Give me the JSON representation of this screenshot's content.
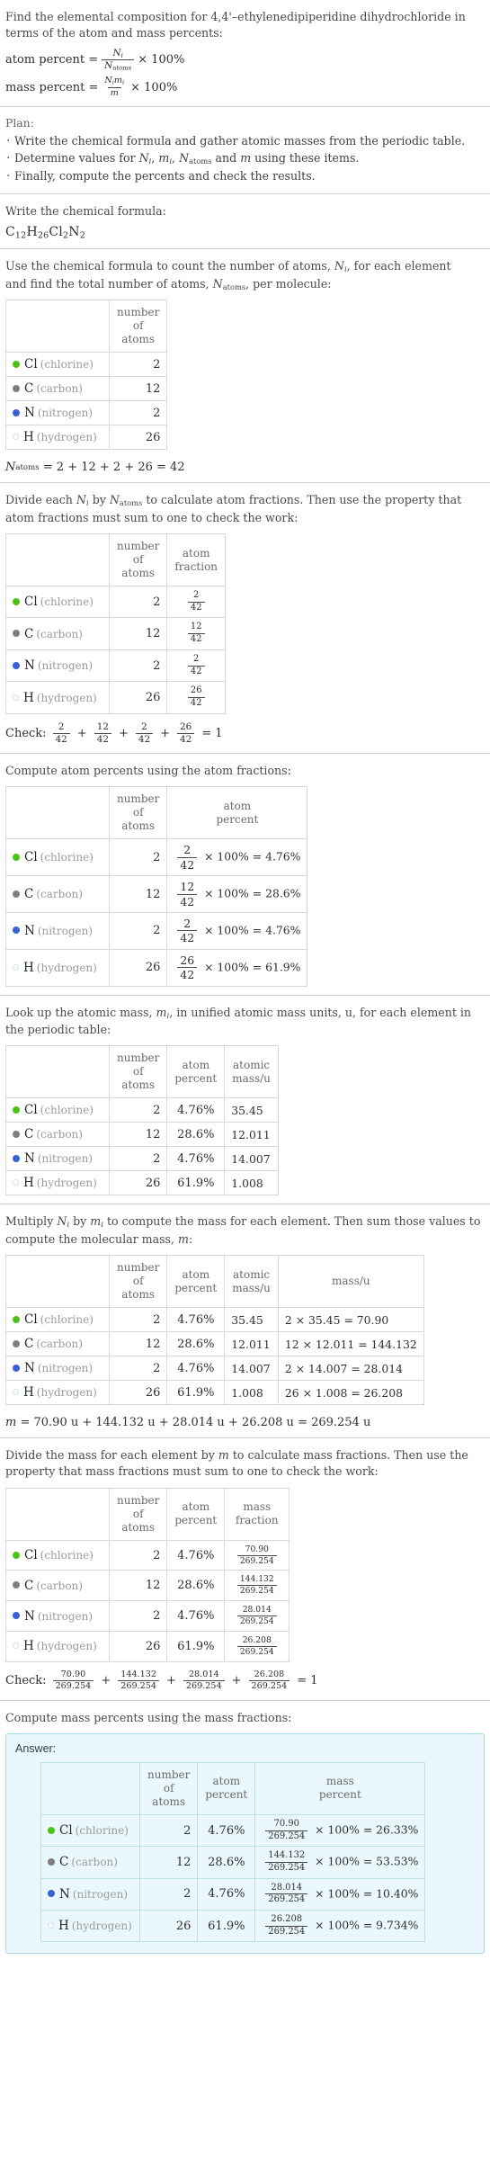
{
  "question": {
    "line1": "Find the elemental composition for 4,4'–ethylenedipiperidine dihydrochloride in",
    "line2": "terms of the atom and mass percents:",
    "atom_percent_label": "atom percent =",
    "mass_percent_label": "mass percent =",
    "percent_factor": "× 100%"
  },
  "plan": {
    "title": "Plan:",
    "bullets": [
      "Write the chemical formula and gather atomic masses from the periodic table.",
      "Determine values for Nᵢ, mᵢ, Nₐₜₒₘₛ and m using these items.",
      "Finally, compute the percents and check the results."
    ],
    "bullet2_parts": {
      "pre": "Determine values for ",
      "post": " using these items."
    }
  },
  "formula_section": {
    "prompt": "Write the chemical formula:",
    "formula_plain": "C12H26Cl2N2",
    "formula_parts": [
      {
        "sym": "C",
        "sub": "12"
      },
      {
        "sym": "H",
        "sub": "26"
      },
      {
        "sym": "Cl",
        "sub": "2"
      },
      {
        "sym": "N",
        "sub": "2"
      }
    ]
  },
  "count_section": {
    "prompt_line1": "Use the chemical formula to count the number of atoms, Nᵢ, for each element",
    "prompt_line2": "and find the total number of atoms, Nₐₜₒₘₛ, per molecule:",
    "headers": [
      "",
      "number of atoms"
    ],
    "total_line": "Nₐₜₒₘₛ = 2 + 12 + 2 + 26 = 42",
    "total_rhs": "= 2 + 12 + 2 + 26 = 42"
  },
  "elements": [
    {
      "symbol": "Cl",
      "name": "(chlorine)",
      "color": "#4cc417",
      "filled": true,
      "count": "2",
      "atom_percent": "4.76%",
      "atomic_mass": "35.45",
      "mass_expr": "2 × 35.45 = 70.90",
      "mass_value": "70.90",
      "mass_percent": "26.33%"
    },
    {
      "symbol": "C",
      "name": "(carbon)",
      "color": "#7f7f7f",
      "filled": true,
      "count": "12",
      "atom_percent": "28.6%",
      "atomic_mass": "12.011",
      "mass_expr": "12 × 12.011 = 144.132",
      "mass_value": "144.132",
      "mass_percent": "53.53%"
    },
    {
      "symbol": "N",
      "name": "(nitrogen)",
      "color": "#3a62d4",
      "filled": true,
      "count": "2",
      "atom_percent": "4.76%",
      "atomic_mass": "14.007",
      "mass_expr": "2 × 14.007 = 28.014",
      "mass_value": "28.014",
      "mass_percent": "10.40%"
    },
    {
      "symbol": "H",
      "name": "(hydrogen)",
      "color": "#c9e4ea",
      "filled": false,
      "count": "26",
      "atom_percent": "61.9%",
      "atomic_mass": "1.008",
      "mass_expr": "26 × 1.008 = 26.208",
      "mass_value": "26.208",
      "mass_percent": "9.734%"
    }
  ],
  "atom_fraction_section": {
    "prompt_line1": "Divide each Nᵢ by Nₐₜₒₘₛ to calculate atom fractions. Then use the property that",
    "prompt_line2": "atom fractions must sum to one to check the work:",
    "headers": [
      "",
      "number of atoms",
      "atom fraction"
    ],
    "denominator": "42",
    "check_label": "Check:",
    "check_result": "= 1"
  },
  "atom_percent_section": {
    "prompt": "Compute atom percents using the atom fractions:",
    "headers": [
      "",
      "number of atoms",
      "atom percent"
    ],
    "denominator": "42",
    "times": "× 100% ="
  },
  "atomic_mass_section": {
    "prompt_line1": "Look up the atomic mass, mᵢ, in unified atomic mass units, u, for each element in",
    "prompt_line2": "the periodic table:",
    "headers": [
      "",
      "number of atoms",
      "atom percent",
      "atomic mass/u"
    ]
  },
  "mass_section": {
    "prompt_line1": "Multiply Nᵢ by mᵢ to compute the mass for each element. Then sum those values to",
    "prompt_line2": "compute the molecular mass, m:",
    "headers": [
      "",
      "number of atoms",
      "atom percent",
      "atomic mass/u",
      "mass/u"
    ],
    "total_line": "m = 70.90 u + 144.132 u + 28.014 u + 26.208 u = 269.254 u",
    "total_rhs": "= 70.90 u + 144.132 u + 28.014 u + 26.208 u = 269.254 u"
  },
  "mass_fraction_section": {
    "prompt_line1": "Divide the mass for each element by m to calculate mass fractions. Then use the",
    "prompt_line2": "property that mass fractions must sum to one to check the work:",
    "headers": [
      "",
      "number of atoms",
      "atom percent",
      "mass fraction"
    ],
    "denominator": "269.254",
    "check_label": "Check:",
    "check_result": "= 1"
  },
  "mass_percent_section": {
    "prompt": "Compute mass percents using the mass fractions:",
    "answer_label": "Answer:",
    "headers": [
      "",
      "number of atoms",
      "atom percent",
      "mass percent"
    ],
    "denominator": "269.254",
    "times": "× 100% ="
  },
  "colors": {
    "answer_bg": "#eaf7fc",
    "answer_border": "#a8d8e8",
    "rule": "#cfcfcf",
    "table_border": "#d8d8d8"
  }
}
